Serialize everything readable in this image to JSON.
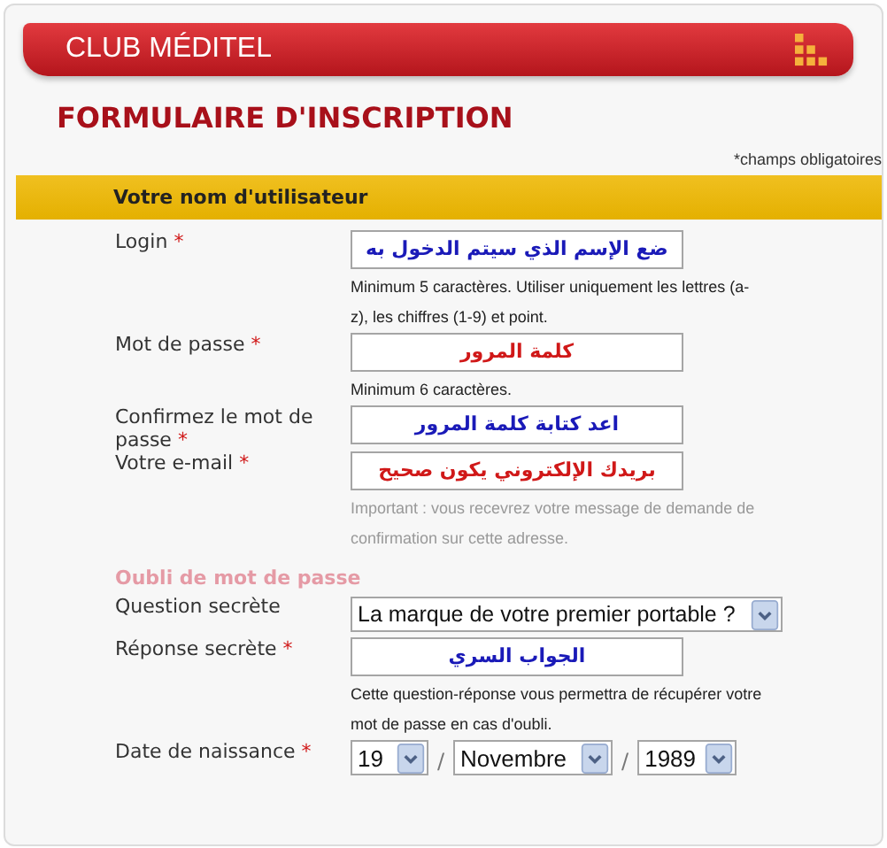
{
  "header": {
    "title": "CLUB MÉDITEL"
  },
  "page_title": "FORMULAIRE D'INSCRIPTION",
  "required_note": "*champs obligatoires",
  "sections": [
    {
      "kind": "bar",
      "title": "Votre nom d'utilisateur",
      "rows": [
        {
          "kind": "text",
          "label": "Login",
          "mark": "*",
          "value": "ضع الإسم الذي سيتم الدخول به",
          "color": "#1a1ab8",
          "hint": "Minimum 5 caractères. Utiliser uniquement les lettres (a-z), les chiffres (1-9) et point.",
          "hint_muted": false
        },
        {
          "kind": "text",
          "label": "Mot de passe",
          "mark": "*",
          "value": "كلمة المرور",
          "color": "#d01818",
          "hint": "Minimum 6 caractères.",
          "hint_muted": false
        },
        {
          "kind": "text",
          "label": "Confirmez le mot de passe",
          "mark": "*",
          "value": "اعد كتابة كلمة المرور",
          "color": "#1a1ab8"
        },
        {
          "kind": "text",
          "label": "Votre e-mail",
          "mark": "*",
          "value": "بريدك الإلكتروني يكون صحيح",
          "color": "#d01818",
          "hint": "Important : vous recevrez votre message de demande de confirmation sur cette adresse.",
          "hint_muted": true
        }
      ]
    },
    {
      "kind": "plain",
      "title": "Oubli de mot de passe",
      "rows": [
        {
          "kind": "select",
          "label": "Question secrète",
          "value": "La marque de votre premier portable ?"
        },
        {
          "kind": "text",
          "label": "Réponse secrète",
          "mark": "*",
          "value": "الجواب السري",
          "color": "#1a1ab8",
          "hint": "Cette question-réponse vous permettra de récupérer votre mot de passe en cas d'oubli.",
          "hint_muted": false
        },
        {
          "kind": "date",
          "label": "Date de naissance",
          "mark": "*",
          "parts": [
            {
              "value": "19"
            },
            {
              "value": "Novembre"
            },
            {
              "value": "1989"
            }
          ],
          "separators": [
            "/",
            "/"
          ]
        }
      ]
    }
  ]
}
